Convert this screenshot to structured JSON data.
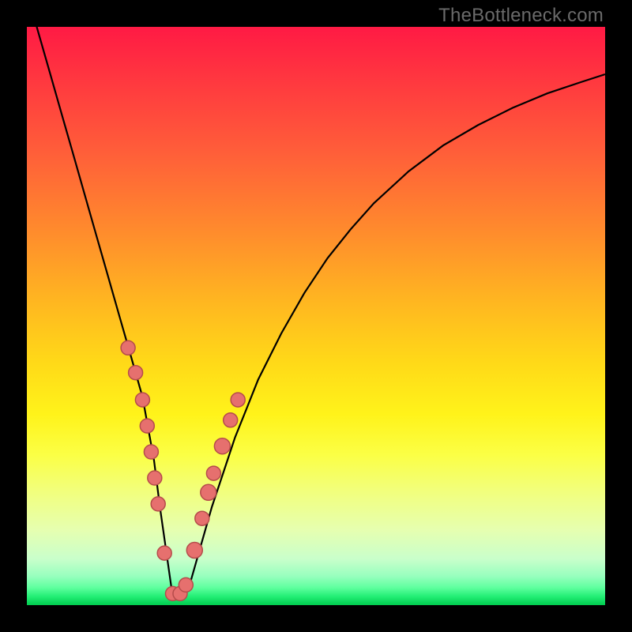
{
  "watermark": "TheBottleneck.com",
  "chart_data": {
    "type": "line",
    "title": "",
    "xlabel": "",
    "ylabel": "",
    "xlim": [
      0,
      100
    ],
    "ylim": [
      0,
      100
    ],
    "grid": false,
    "legend": false,
    "series": [
      {
        "name": "bottleneck-curve",
        "x": [
          0,
          2,
          4,
          6,
          8,
          10,
          12,
          14,
          16,
          18,
          20,
          22,
          23,
          24,
          25,
          26,
          27,
          28,
          30,
          32,
          34,
          36,
          38,
          40,
          44,
          48,
          52,
          56,
          60,
          66,
          72,
          78,
          84,
          90,
          96,
          100
        ],
        "y": [
          106,
          99,
          92,
          85,
          78,
          71,
          64,
          57,
          50,
          43,
          36,
          25,
          17,
          10,
          3,
          1,
          1,
          3,
          10,
          17,
          23,
          29,
          34,
          39,
          47,
          54,
          60,
          65,
          69.5,
          75,
          79.5,
          83,
          86,
          88.5,
          90.5,
          91.8
        ]
      }
    ],
    "scatter_points": {
      "name": "highlighted-data-points",
      "x": [
        17.5,
        18.8,
        20.0,
        20.8,
        21.5,
        22.1,
        22.7,
        23.8,
        25.2,
        26.5,
        27.5,
        29.0,
        30.3,
        31.4,
        32.3,
        33.8,
        35.2,
        36.5
      ],
      "y": [
        44.5,
        40.2,
        35.5,
        31.0,
        26.5,
        22.0,
        17.5,
        9.0,
        2.0,
        2.0,
        3.5,
        9.5,
        15.0,
        19.5,
        22.8,
        27.5,
        32.0,
        35.5
      ],
      "radius": [
        9,
        9,
        9,
        9,
        9,
        9,
        9,
        9,
        9,
        9,
        9,
        10,
        9,
        10,
        9,
        10,
        9,
        9
      ]
    },
    "background_gradient": {
      "top_color": "#ff1a44",
      "mid_color": "#ffd918",
      "bottom_color": "#00cc4f"
    }
  }
}
